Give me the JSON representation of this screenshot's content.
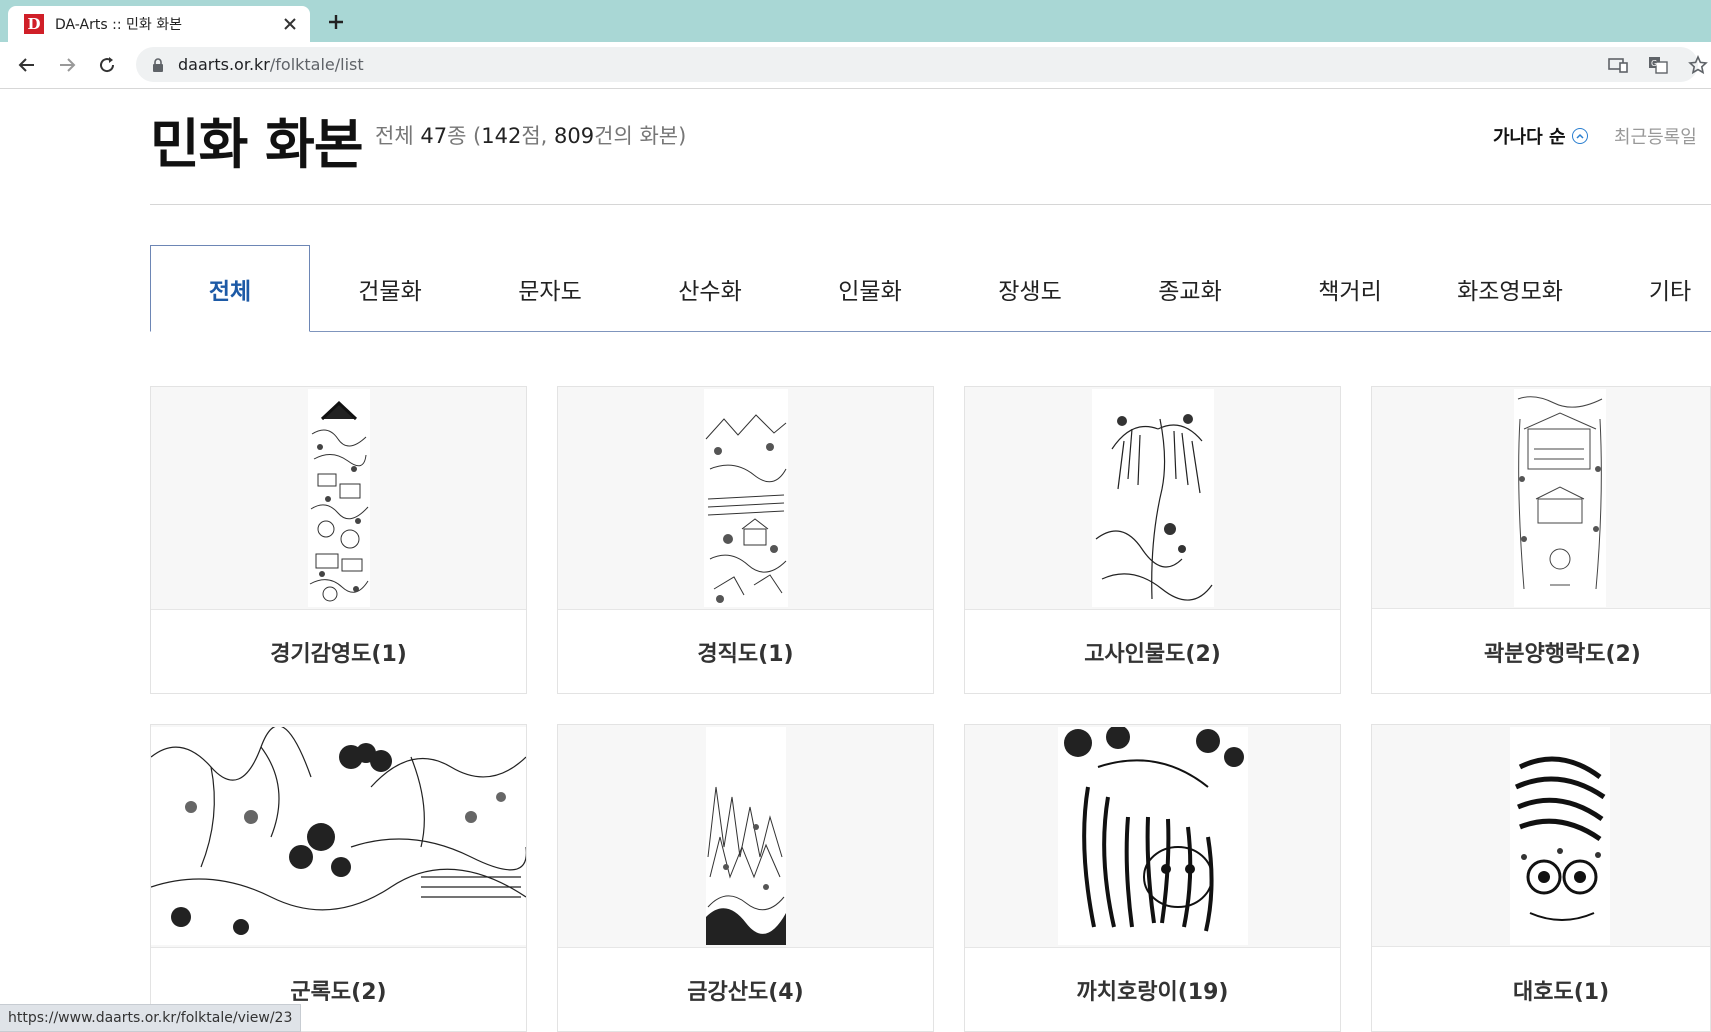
{
  "browser": {
    "tab_title": "DA-Arts :: 민화 화본",
    "favicon_letter": "D",
    "url_host": "daarts.or.kr",
    "url_path": "/folktale/list",
    "status_url": "https://www.daarts.or.kr/folktale/view/23"
  },
  "page": {
    "title": "민화 화본",
    "count": {
      "prefix": "전체 ",
      "kinds": "47",
      "kinds_unit": "종 (",
      "items": "142",
      "items_unit": "점, ",
      "drafts": "809",
      "drafts_unit": "건의 화본)"
    },
    "sort": {
      "active": "가나다 순",
      "other": "최근등록일"
    }
  },
  "categories": [
    {
      "label": "전체",
      "active": true
    },
    {
      "label": "건물화"
    },
    {
      "label": "문자도"
    },
    {
      "label": "산수화"
    },
    {
      "label": "인물화"
    },
    {
      "label": "장생도"
    },
    {
      "label": "종교화"
    },
    {
      "label": "책거리"
    },
    {
      "label": "화조영모화"
    },
    {
      "label": "기타"
    }
  ],
  "cards": [
    {
      "label": "경기감영도(1)"
    },
    {
      "label": "경직도(1)"
    },
    {
      "label": "고사인물도(2)"
    },
    {
      "label": "곽분양행락도(2)"
    },
    {
      "label": "군록도(2)"
    },
    {
      "label": "금강산도(4)"
    },
    {
      "label": "까치호랑이(19)"
    },
    {
      "label": "대호도(1)"
    }
  ],
  "colors": {
    "tabbar": "#a9d7d5",
    "active_category": "#1d5aa6",
    "favicon": "#d01f28"
  }
}
